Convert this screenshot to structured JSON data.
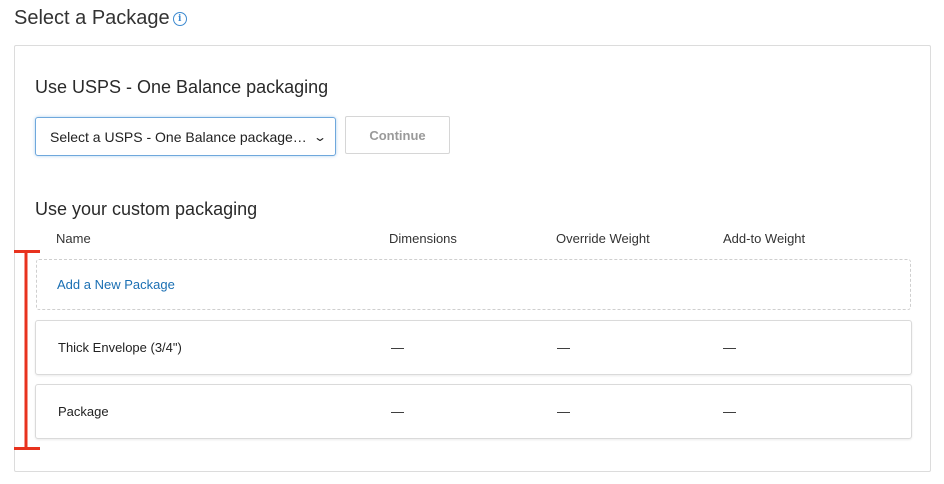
{
  "header": {
    "title": "Select a Package",
    "info_icon": "info-icon"
  },
  "usps": {
    "heading": "Use USPS - One Balance packaging",
    "select_value": "Select a USPS - One Balance package…",
    "continue_label": "Continue"
  },
  "custom": {
    "heading": "Use your custom packaging",
    "columns": [
      "Name",
      "Dimensions",
      "Override Weight",
      "Add-to Weight"
    ],
    "add_link": "Add a New Package",
    "rows": [
      {
        "name": "Thick Envelope (3/4\")",
        "dimensions": "—",
        "override_weight": "—",
        "add_to_weight": "—"
      },
      {
        "name": "Package",
        "dimensions": "—",
        "override_weight": "—",
        "add_to_weight": "—"
      }
    ]
  },
  "colors": {
    "accent": "#1a6fb3",
    "annotation": "#e8321e"
  }
}
